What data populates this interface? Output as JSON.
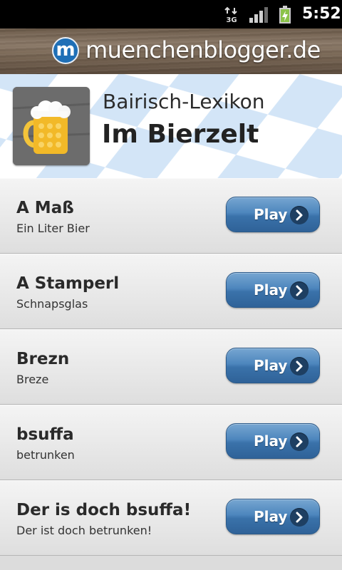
{
  "status_bar": {
    "network_label": "3G",
    "time": "5:52",
    "icons": [
      "network-3g-icon",
      "signal-strength-icon",
      "battery-charging-icon"
    ]
  },
  "brand": {
    "logo_letter": "m",
    "name": "muenchenblogger.de"
  },
  "header": {
    "subtitle": "Bairisch-Lexikon",
    "title": "Im Bierzelt",
    "thumbnail_icon": "beer-mug-icon"
  },
  "entries": [
    {
      "term": "A Maß",
      "meaning": "Ein Liter Bier",
      "button": "Play"
    },
    {
      "term": "A Stamperl",
      "meaning": "Schnapsglas",
      "button": "Play"
    },
    {
      "term": "Brezn",
      "meaning": "Breze",
      "button": "Play"
    },
    {
      "term": "bsuffa",
      "meaning": "betrunken",
      "button": "Play"
    },
    {
      "term": "Der is doch bsuffa!",
      "meaning": "Der ist doch betrunken!",
      "button": "Play"
    }
  ],
  "colors": {
    "button_blue": "#4d86bd",
    "bavarian_blue": "#cfe3f7",
    "status_bar": "#000000"
  }
}
